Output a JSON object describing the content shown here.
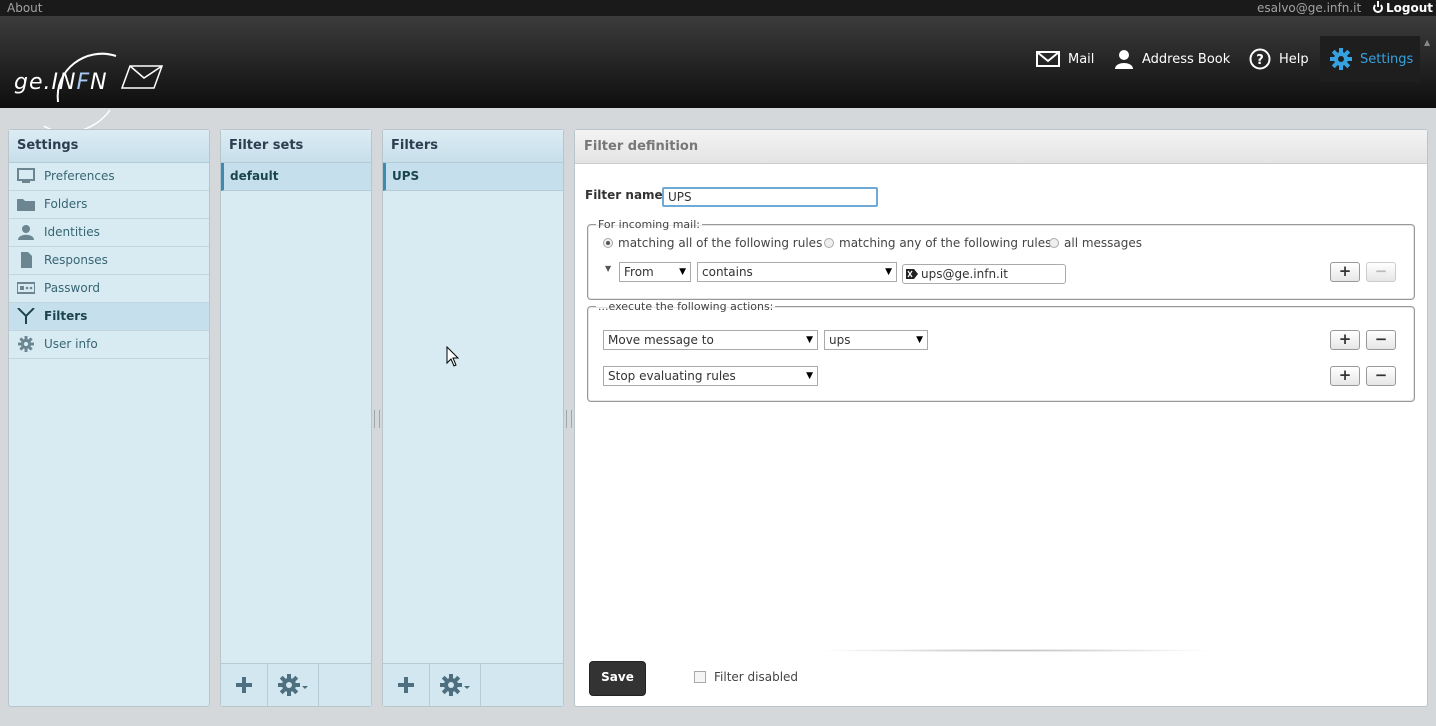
{
  "topbar": {
    "about": "About",
    "user": "esalvo@ge.infn.it",
    "logout": "Logout"
  },
  "logo": {
    "ge": "ge.",
    "i": "I",
    "n1": "N",
    "f": "F",
    "n2": "N"
  },
  "nav": {
    "mail": "Mail",
    "address_book": "Address Book",
    "help": "Help",
    "settings": "Settings"
  },
  "settings_panel": {
    "title": "Settings",
    "items": [
      {
        "label": "Preferences",
        "icon": "monitor-icon"
      },
      {
        "label": "Folders",
        "icon": "folder-icon"
      },
      {
        "label": "Identities",
        "icon": "person-icon"
      },
      {
        "label": "Responses",
        "icon": "document-icon"
      },
      {
        "label": "Password",
        "icon": "password-icon"
      },
      {
        "label": "Filters",
        "icon": "filter-icon"
      },
      {
        "label": "User info",
        "icon": "gear-icon"
      }
    ]
  },
  "filter_sets": {
    "title": "Filter sets",
    "items": [
      "default"
    ]
  },
  "filters": {
    "title": "Filters",
    "items": [
      "UPS"
    ]
  },
  "definition": {
    "title": "Filter definition",
    "name_label": "Filter name:",
    "name_value": "UPS",
    "incoming_legend": "For incoming mail:",
    "radio_all": "matching all of the following rules",
    "radio_any": "matching any of the following rules",
    "radio_messages": "all messages",
    "rule_header": "From",
    "rule_op": "contains",
    "rule_value": "ups@ge.infn.it",
    "actions_legend": "...execute the following actions:",
    "action1": "Move message to",
    "action1_target": "ups",
    "action2": "Stop evaluating rules",
    "plus": "+",
    "minus": "−",
    "save": "Save",
    "disabled_label": "Filter disabled"
  },
  "colors": {
    "accent": "#37a2e0",
    "panel": "#d8ebf3"
  }
}
